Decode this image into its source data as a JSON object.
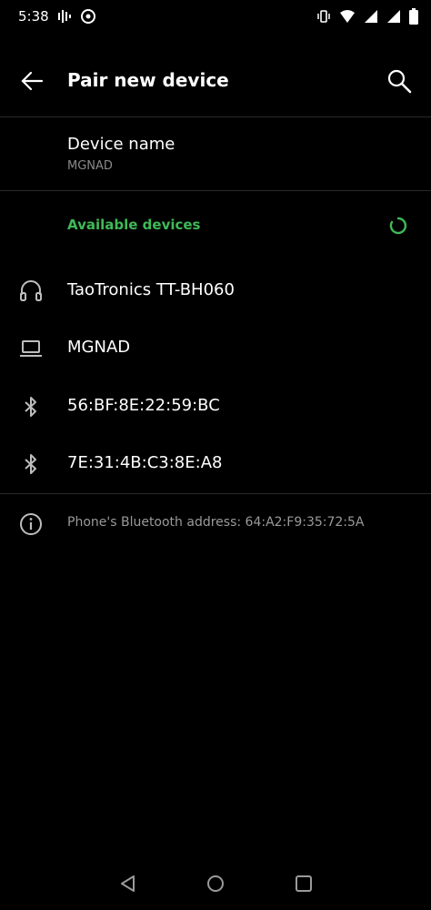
{
  "status": {
    "time": "5:38"
  },
  "appbar": {
    "title": "Pair new device"
  },
  "device_name": {
    "title": "Device name",
    "value": "MGNAD"
  },
  "available": {
    "section_label": "Available devices",
    "devices": [
      {
        "name": "TaoTronics TT-BH060",
        "icon": "headphones-icon"
      },
      {
        "name": "MGNAD",
        "icon": "laptop-icon"
      },
      {
        "name": "56:BF:8E:22:59:BC",
        "icon": "bluetooth-icon"
      },
      {
        "name": "7E:31:4B:C3:8E:A8",
        "icon": "bluetooth-icon"
      }
    ]
  },
  "info": {
    "text": "Phone's Bluetooth address: 64:A2:F9:35:72:5A"
  },
  "colors": {
    "accent": "#3fb957",
    "background": "#000000",
    "secondary_text": "#8a8a8a"
  }
}
